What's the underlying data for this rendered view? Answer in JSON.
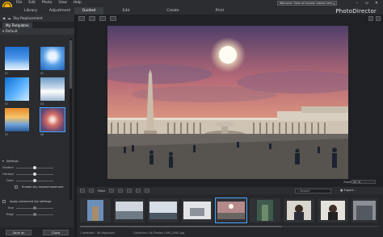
{
  "app": {
    "brand": "PhotoDirector"
  },
  "menu": [
    "File",
    "Edit",
    "Photo",
    "View",
    "Help"
  ],
  "modes": [
    {
      "label": "Library",
      "w": 36
    },
    {
      "label": "Adjustment",
      "w": 36
    },
    {
      "label": "Guided",
      "w": 36
    },
    {
      "label": "Edit",
      "w": 36
    },
    {
      "label": "Create",
      "w": 36
    },
    {
      "label": "Print",
      "w": 36
    }
  ],
  "welcome": "Welcome: View all tutorial videos here",
  "panel": {
    "title": "Sky Replacement",
    "tab": "My Templates",
    "section": "Default",
    "thumb_labels": [
      "01",
      "02",
      "03",
      "04",
      "05",
      "06"
    ],
    "settings_label": "Settings",
    "sliders": [
      {
        "name": "Feather",
        "value": 0.5
      },
      {
        "name": "Horizon",
        "value": 0.5
      },
      {
        "name": "Color",
        "value": 0.5
      }
    ],
    "enable_sky": "Enable sky resize/movement",
    "advanced": "Apply advanced sky settings",
    "adv_sliders": [
      {
        "name": "Hue",
        "value": 0.5
      },
      {
        "name": "Edge",
        "value": 0.5
      }
    ]
  },
  "buttons": {
    "save": "Save as",
    "close": "Close"
  },
  "viewer": {
    "zoom_label": "Zoom:",
    "zoom_value": "32 %"
  },
  "strip": {
    "filter": "Filter",
    "search_placeholder": "Search",
    "export": "Export...",
    "status_left": "1 selected - 46 displayed",
    "status_path": "Collection / All Photos / IMG_0461.jpg"
  }
}
